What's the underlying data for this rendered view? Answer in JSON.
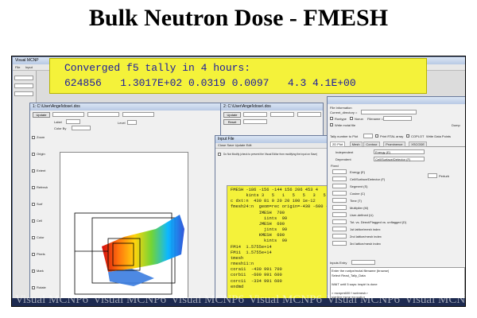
{
  "slide": {
    "title": "Bulk Neutron Dose - FMESH"
  },
  "callout": {
    "line1": "Converged f5 tally in 4 hours:",
    "line2": "624856   1.3017E+02 0.0319 0.0097   4.3 4.1E+00"
  },
  "main_window": {
    "title": "Visual MCNP",
    "menu_file": "File",
    "menu_input": "Input"
  },
  "plot_window": {
    "title": "1: C:\\User\\Angel\\dose\\.dos",
    "update_btn": "Update",
    "label_field": "Label",
    "color_by": "Color By",
    "level": "Level",
    "sidebar": [
      "Zoom",
      "Origin",
      "Extent",
      "Refresh",
      "Surf",
      "Cell",
      "Color",
      "Pixels",
      "Mark",
      "Rotate"
    ]
  },
  "plot2_window": {
    "title": "2: C:\\User\\Angel\\dose\\.dos",
    "update_btn": "Update",
    "reset_btn": "Reset"
  },
  "input_window": {
    "title": "Input File",
    "menu": "Close    Save    Update    Edit",
    "warning": "Do Not Modify (check to prevent the Visual Editor from modifying the input on Save)",
    "lines": [
      "FMESH -186 -156 -144 156 206 453 4",
      "      kints 3   5   1   5   5   3   5",
      "c dxt:n  430 81 0 20 20 100 1e-12",
      "fmesh24:n  geom=rec origin=-430 -600 -334",
      "           IMESH  700",
      "             iints  99",
      "           JMESH  600",
      "             jints  99",
      "           KMESH  600",
      "             kints  99",
      "FM14  1.5755e+14",
      "FM11  1.5755e+14",
      "tmesh",
      "rmesh11:n",
      "cora11  -430 991 700",
      "corb11  -600 991 600",
      "corc11  -334 991 600",
      "endmd"
    ]
  },
  "tally_window": {
    "header": "File Information",
    "current_dir": "Current_directory =",
    "runtype": "Runtype",
    "norun": "Norun",
    "filename": "Filename =",
    "write_mctal": "Write mctal file",
    "dump": "Dump",
    "tally_number": "Tally number to Plot",
    "print_rtal": "Print RTAL array",
    "coplot": "COPLOT",
    "write_data": "Write Data Points",
    "tabs": [
      "2D Plot",
      "Mesh",
      "Contour",
      "Prominence",
      "XSCODE"
    ],
    "independent_label": "Independent",
    "independent_value": "Energy (E)",
    "dependent_label": "Dependent",
    "dependent_value": "Cell/Surface/Detector (F)",
    "fixed_label": "Fixed",
    "perturb": "Perturb",
    "fixed_items": [
      "Energy (E)",
      "Cell/Surface/Detector (F)",
      "Segment (S)",
      "Cosine (C)",
      "Time (T)",
      "Multiplier (M)",
      "User-defined (U)",
      "Tot. vs. Direct/Flagged vs. unflagged (D)",
      "1st lattice/mesh index",
      "2nd lattice/mesh index",
      "3rd lattice/mesh index"
    ],
    "status_header": "Inputs Entry",
    "status_lines": [
      "Enter the runtpe/mctal filename (browse)",
      "Select Read_Tally_Data",
      "",
      "WAIT until 5 says: inspiri is done",
      "",
      "> mcnpm600 f runtmesh r",
      "  starting mcnp execution",
      "  inspiri is done"
    ]
  },
  "watermark": {
    "text": "Visual MCNP6"
  },
  "colors": {
    "callout_bg": "#f4f23a",
    "callout_text": "#1a1aa0",
    "desktop": "#2a3a6a"
  }
}
